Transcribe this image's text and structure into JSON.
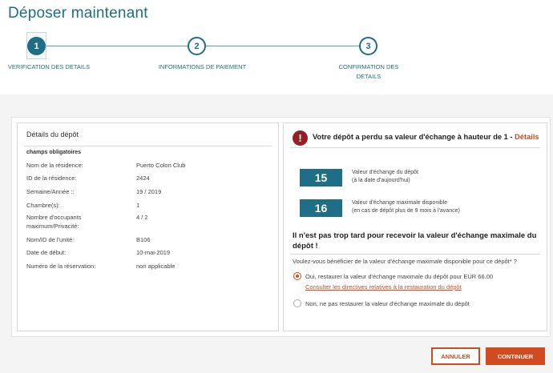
{
  "header": {
    "title": "Déposer maintenant"
  },
  "stepper": {
    "steps": [
      {
        "number": "1",
        "label": "VERIFICATION DES DETAILS"
      },
      {
        "number": "2",
        "label": "INFORMATIONS DE PAIEMENT"
      },
      {
        "number": "3",
        "label_line1": "CONFIRMATION DES",
        "label_line2": "DETAILS"
      }
    ]
  },
  "details": {
    "title": "Détails du dépôt",
    "required_note": "champs obligatoires",
    "rows": [
      {
        "label": "Nom de la résidence:",
        "value": "Puerto Colon Club"
      },
      {
        "label": "ID de la résidence:",
        "value": "2424"
      },
      {
        "label": "Semaine/Année ::",
        "value": "19 / 2019"
      },
      {
        "label": "Chambre(s):",
        "value": "1"
      },
      {
        "label_line1": "Nombre d'occupants",
        "label_line2": "maximum/Privacité:",
        "value": "4 / 2"
      },
      {
        "label": "Nom/ID de l'unité:",
        "value": "B106"
      },
      {
        "label": "Date de début:",
        "value": "10-mai-2019"
      },
      {
        "label": "Numéro de la réservation:",
        "value": "non applicable"
      }
    ]
  },
  "alert": {
    "message": "Votre dépôt a perdu sa valeur d'échange à hauteur de 1 - ",
    "link": "Détails"
  },
  "values": [
    {
      "value": "15",
      "line1": "Valeur d'échange du dépôt",
      "line2": "(à la date d'aujourd'hui)"
    },
    {
      "value": "16",
      "line1": "Valeur d'échange maximale disponible",
      "line2": "(en cas de dépôt plus de 9 mois à l'avance)"
    }
  ],
  "restore": {
    "title": "Il n'est pas trop tard pour recevoir la valeur d'échange maximale du dépôt !",
    "question": "Voulez-vous bénéficier de la valeur d'échange maximale disponible pour ce dépôt* ?",
    "option_yes": "Oui, restaurer la valeur d'échange maximale du dépôt pour EUR 66.00",
    "policy_link": "Consulter les directives relatives à la restauration du dépôt",
    "option_no": "Non, ne pas restaurer la valeur d'échange maximale du dépôt"
  },
  "buttons": {
    "cancel": "ANNULER",
    "continue": "CONTINUER"
  },
  "colors": {
    "brand": "#1e6e86",
    "accent": "#d24b1e",
    "alert": "#9c1c24"
  }
}
